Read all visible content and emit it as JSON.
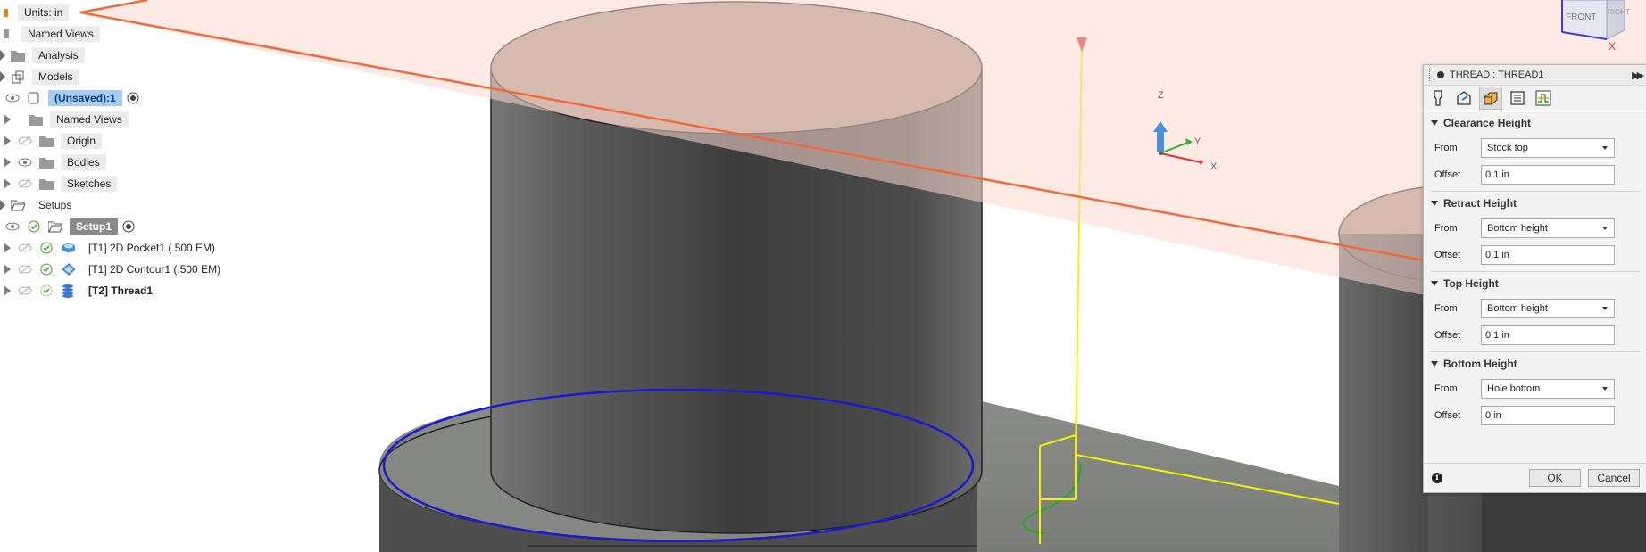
{
  "browser": {
    "units": "Units: in",
    "items": [
      {
        "label": "Named Views"
      },
      {
        "label": "Analysis"
      },
      {
        "label": "Models"
      },
      {
        "label": "(Unsaved):1"
      },
      {
        "label": "Named Views"
      },
      {
        "label": "Origin"
      },
      {
        "label": "Bodies"
      },
      {
        "label": "Sketches"
      },
      {
        "label": "Setups"
      },
      {
        "label": "Setup1"
      },
      {
        "label": "[T1] 2D Pocket1 (.500 EM)"
      },
      {
        "label": "[T1] 2D Contour1 (.500 EM)"
      },
      {
        "label": "[T2] Thread1"
      }
    ]
  },
  "triad": {
    "x": "X",
    "y": "Y",
    "z": "Z"
  },
  "viewcube": {
    "front": "FRONT",
    "right": "RIGHT",
    "x": "X"
  },
  "dialog": {
    "title": "THREAD : THREAD1",
    "sections": [
      {
        "title": "Clearance Height",
        "from_label": "From",
        "from_value": "Stock top",
        "offset_label": "Offset",
        "offset_value": "0.1 in"
      },
      {
        "title": "Retract Height",
        "from_label": "From",
        "from_value": "Bottom height",
        "offset_label": "Offset",
        "offset_value": "0.1 in"
      },
      {
        "title": "Top Height",
        "from_label": "From",
        "from_value": "Bottom height",
        "offset_label": "Offset",
        "offset_value": "0.1 in"
      },
      {
        "title": "Bottom Height",
        "from_label": "From",
        "from_value": "Hole bottom",
        "offset_label": "Offset",
        "offset_value": "0 in"
      }
    ],
    "ok_label": "OK",
    "cancel_label": "Cancel"
  },
  "colors": {
    "plane_fill": "#fcd9d0",
    "plane_edge": "#f06a3c",
    "body_dark": "#4a4a4a",
    "cap_top": "#a9958b",
    "toolpath_blue": "#1a1ad0",
    "toolpath_yellow": "#f2f200",
    "toolpath_green": "#22aa22",
    "selection_blue": "#a8cdf2"
  }
}
